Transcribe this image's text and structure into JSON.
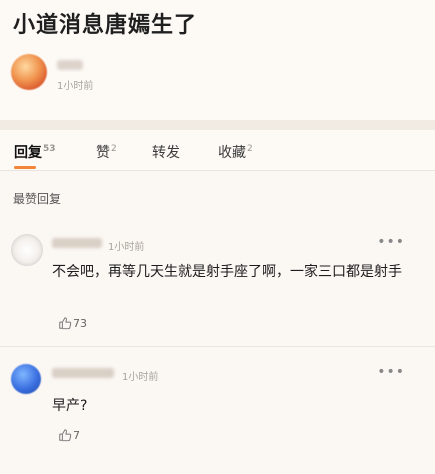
{
  "post": {
    "title": "小道消息唐嫣生了",
    "time": "1小时前"
  },
  "tabs": [
    {
      "label": "回复",
      "count": "53",
      "active": true
    },
    {
      "label": "赞",
      "count": "2",
      "active": false
    },
    {
      "label": "转发",
      "count": "",
      "active": false
    },
    {
      "label": "收藏",
      "count": "2",
      "active": false
    }
  ],
  "sort_label": "最赞回复",
  "comments": [
    {
      "time": "1小时前",
      "text": "不会吧，再等几天生就是射手座了啊，一家三口都是射手",
      "likes": "73"
    },
    {
      "time": "1小时前",
      "text": "早产?",
      "likes": "7"
    }
  ],
  "icons": {
    "more": "more-icon",
    "like": "thumbs-up-icon"
  },
  "colors": {
    "accent": "#f2853a",
    "background": "#fbf7f3"
  }
}
